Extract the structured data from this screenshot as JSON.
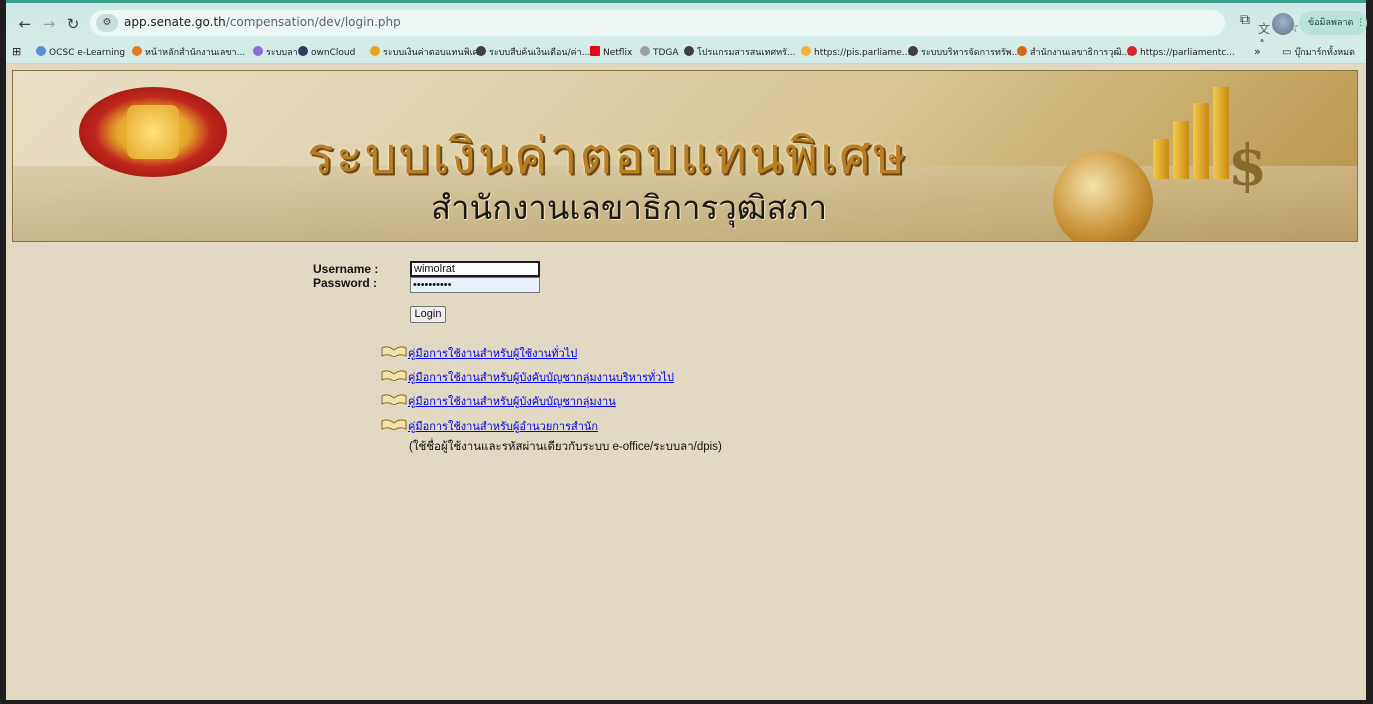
{
  "browser": {
    "url_domain": "app.senate.go.th",
    "url_path": "/compensation/dev/login.php",
    "profile_label": "ข้อมิลพลาด",
    "bookmarks": [
      "OCSC e-Learning",
      "หน้าหลักสำนักงานเลขา...",
      "ระบบลา",
      "ownCloud",
      "ระบบเงินค่าตอบแทนพิเศษ",
      "ระบบสืบค้นเงินเดือน/ค่า...",
      "Netflix",
      "TDGA",
      "โปรแกรมสารสนเทศทรั...",
      "https://pis.parliame...",
      "ระบบบริหารจัดการทรัพ...",
      "สำนักงานเลขาธิการวุฒิ...",
      "https://parliamentc..."
    ],
    "bookmarks_overflow": "»",
    "all_bookmarks": "บุ๊กมาร์กทั้งหมด"
  },
  "banner": {
    "title": "ระบบเงินค่าตอบแทนพิเศษ",
    "subtitle": "สำนักงานเลขาธิการวุฒิสภา"
  },
  "login": {
    "username_label": "Username :",
    "password_label": "Password :",
    "username_value": "wimolrat",
    "password_value": "••••••••••",
    "login_button": "Login"
  },
  "manuals": [
    "คู่มือการใช้งานสำหรับผู้ใช้งานทั่วไป",
    "คู่มือการใช้งานสำหรับผู้บังคับบัญชากลุ่มงานบริหารทั่วไป",
    "คู่มือการใช้งานสำหรับผู้บังคับบัญชากลุ่มงาน",
    "คู่มือการใช้งานสำหรับผู้อำนวยการสำนัก"
  ],
  "note": "(ใช้ชื่อผู้ใช้งานและรหัสผ่านเดียวกับระบบ e-office/ระบบลา/dpis)",
  "colors": {
    "accent": "#3aa08d",
    "page_background": "#e2d9c3",
    "link": "#0000ee"
  }
}
